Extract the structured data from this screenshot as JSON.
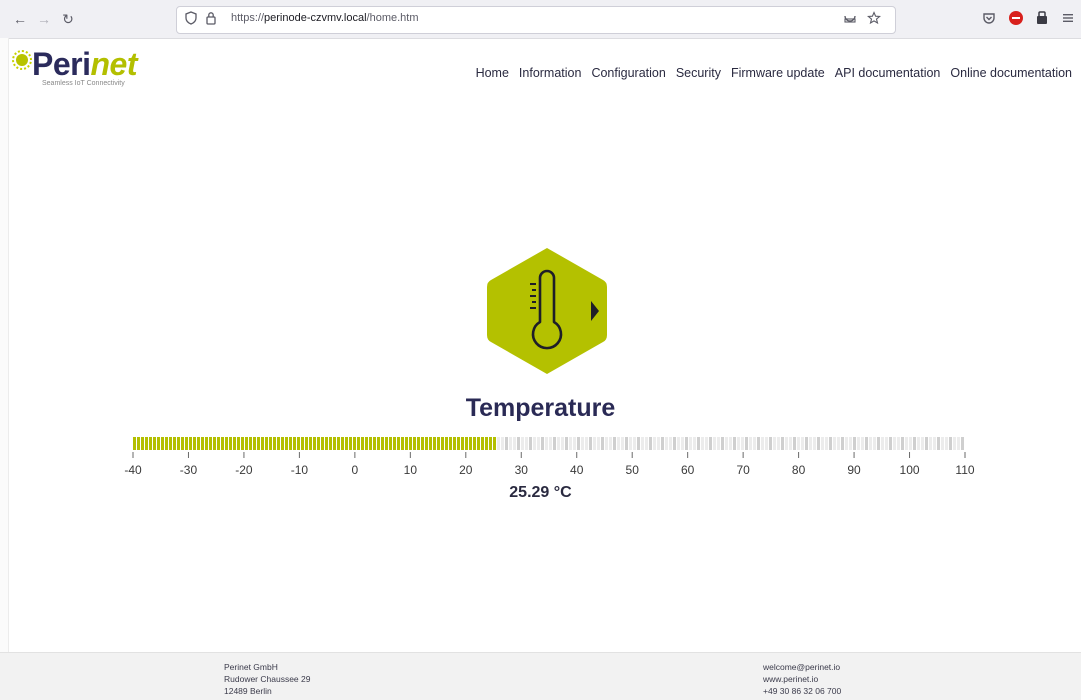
{
  "browser": {
    "url_prefix": "https://",
    "url_host": "perinode-czvmv.local",
    "url_path": "/home.htm"
  },
  "brand": {
    "name_a": "Peri",
    "name_b": "net",
    "tagline": "Seamless IoT Connectivity",
    "accent": "#b3bf00",
    "navy": "#2a2a55"
  },
  "nav": {
    "items": [
      "Home",
      "Information",
      "Configuration",
      "Security",
      "Firmware update",
      "API documentation",
      "Online documentation"
    ]
  },
  "sensor": {
    "icon": "thermometer-icon",
    "title": "Temperature",
    "value_text": "25.29 °C",
    "value": 25.29,
    "min": -40,
    "max": 110,
    "ticks": [
      "-40",
      "-30",
      "-20",
      "-10",
      "0",
      "10",
      "20",
      "30",
      "40",
      "50",
      "60",
      "70",
      "80",
      "90",
      "100",
      "110"
    ]
  },
  "footer": {
    "left": [
      "Perinet GmbH",
      "Rudower Chaussee 29",
      "12489 Berlin"
    ],
    "right": [
      "welcome@perinet.io",
      "www.perinet.io",
      "+49 30 86 32 06 700"
    ]
  }
}
